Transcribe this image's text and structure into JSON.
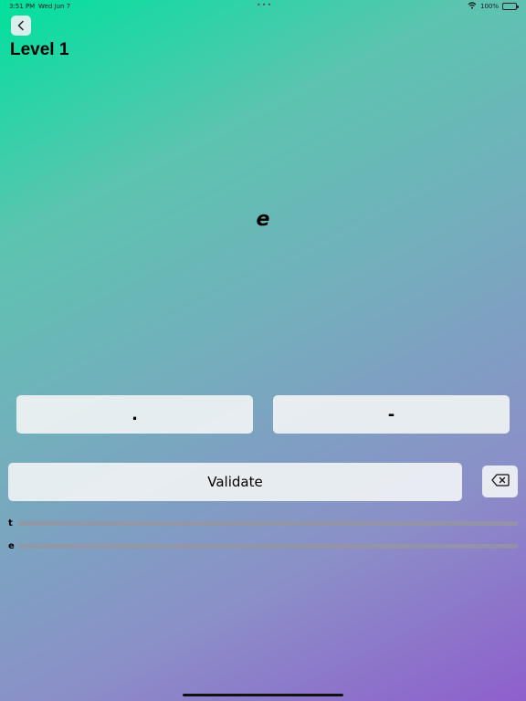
{
  "status_bar": {
    "time": "3:51 PM",
    "date": "Wed Jun 7",
    "dots": "•••",
    "battery": "100%",
    "icons": [
      "wifi-icon",
      "battery-icon"
    ]
  },
  "header": {
    "back_icon": "chevron-left-icon",
    "title": "Level 1"
  },
  "main": {
    "current_letter": "e"
  },
  "keypad": {
    "dot_label": ".",
    "dash_label": "-",
    "validate_label": "Validate",
    "delete_icon": "backspace-icon"
  },
  "history": [
    {
      "letter": "t"
    },
    {
      "letter": "e"
    }
  ]
}
